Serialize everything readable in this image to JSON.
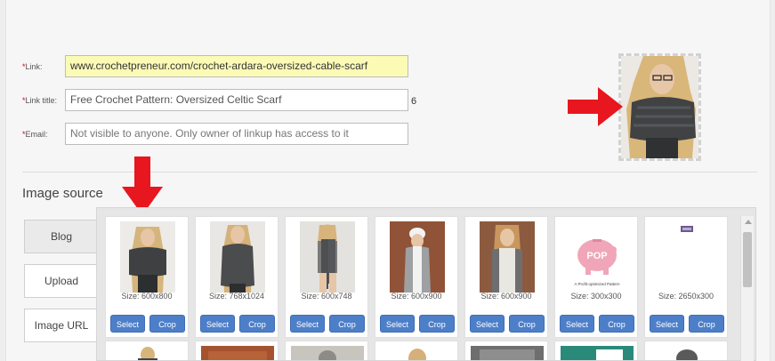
{
  "form": {
    "link": {
      "label": "Link:",
      "value": "www.crochetpreneur.com/crochet-ardara-oversized-cable-scarf"
    },
    "link_title": {
      "label": "Link title:",
      "value": "Free Crochet Pattern: Oversized Celtic Scarf",
      "counter": "6"
    },
    "email": {
      "label": "Email:",
      "placeholder": "Not visible to anyone. Only owner of linkup has access to it"
    }
  },
  "required_mark": "*",
  "image_source": {
    "title": "Image source",
    "tabs": [
      {
        "label": "Blog",
        "active": true
      },
      {
        "label": "Upload",
        "active": false
      },
      {
        "label": "Image URL",
        "active": false
      }
    ],
    "images": [
      {
        "size": "Size: 600x800",
        "thumb_color": "#7a7570"
      },
      {
        "size": "Size: 768x1024",
        "thumb_color": "#8a8580"
      },
      {
        "size": "Size: 600x748",
        "thumb_color": "#8e8b86"
      },
      {
        "size": "Size: 600x900",
        "thumb_color": "#8a5a3e"
      },
      {
        "size": "Size: 600x900",
        "thumb_color": "#8b5e42"
      },
      {
        "size": "Size: 300x300",
        "thumb_color": "#f0a6b8",
        "logo_text": "POP",
        "caption": "A Profit-optimized Pattern"
      },
      {
        "size": "Size: 2650x300",
        "thumb_color": "#ffffff"
      }
    ],
    "select_label": "Select",
    "crop_label": "Crop",
    "second_row_colors": [
      "#b8b4ae",
      "#a5532e",
      "#c8c4be",
      "#d5cdc2",
      "#6e6e6e",
      "#2a8a7a",
      "#d6d2cc"
    ]
  },
  "colors": {
    "accent": "#4d7fc9",
    "arrow": "#e8161e",
    "link_bg": "#fbfbb6"
  }
}
